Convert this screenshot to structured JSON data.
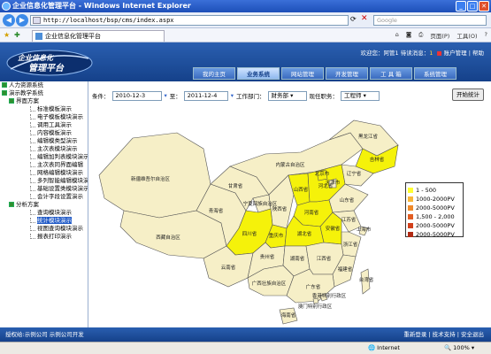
{
  "window": {
    "title": "企业信息化管理平台 - Windows Internet Explorer"
  },
  "addressbar": {
    "url": "http://localhost/bsp/cms/index.aspx",
    "search_placeholder": "Google"
  },
  "tab": {
    "label": "企业信息化管理平台"
  },
  "toolbar": {
    "page_label": "页面(P)",
    "tools_label": "工具(O)"
  },
  "header": {
    "logo_text": "企业信息化管理平台",
    "welcome": "欢迎您：阿管1  待读消息：",
    "msg_count": "1",
    "account": "账户管理",
    "help": "帮助"
  },
  "nav": {
    "tabs": [
      "我的主页",
      "业务系统",
      "网站管理",
      "开发管理",
      "工 具 箱",
      "系统管理"
    ],
    "active": 1
  },
  "sidebar": {
    "items": [
      {
        "label": "人力资源系统",
        "level": 0
      },
      {
        "label": "演示教学系统",
        "level": 0
      },
      {
        "label": "界面方案",
        "level": 1
      },
      {
        "label": "标准模板演示",
        "level": 2
      },
      {
        "label": "电子模板模块演示",
        "level": 2
      },
      {
        "label": "调用工具演示",
        "level": 2
      },
      {
        "label": "内容模板演示",
        "level": 2
      },
      {
        "label": "编辑模类型演示",
        "level": 2
      },
      {
        "label": "主次表模块演示",
        "level": 2
      },
      {
        "label": "编辑加判表模块演示",
        "level": 2
      },
      {
        "label": "主次表同界面编辑",
        "level": 2
      },
      {
        "label": "网格编辑模块演示",
        "level": 2
      },
      {
        "label": "多列智能编辑模块演示",
        "level": 2
      },
      {
        "label": "基础设置类模块演示",
        "level": 2
      },
      {
        "label": "会计字段设置演示",
        "level": 2
      },
      {
        "label": "分析方案",
        "level": 1
      },
      {
        "label": "查询模块演示",
        "level": 2
      },
      {
        "label": "统计模块演示",
        "level": 2,
        "selected": true
      },
      {
        "label": "视图查询模块演示",
        "level": 2
      },
      {
        "label": "报表打印演示",
        "level": 2
      }
    ]
  },
  "filter": {
    "start_label": "条件：",
    "start_date": "2010-12-3",
    "to_label": "至：",
    "end_date": "2011-12-4",
    "dept_label": "工作部门：",
    "dept_value": "财务部",
    "job_label": "现任职务：",
    "job_value": "工程师",
    "stats_button": "开始统计"
  },
  "map": {
    "provinces": [
      {
        "name": "新疆维吾尔自治区",
        "highlight": false
      },
      {
        "name": "西藏自治区",
        "highlight": false
      },
      {
        "name": "青海省",
        "highlight": false
      },
      {
        "name": "甘肃省",
        "highlight": false
      },
      {
        "name": "内蒙古自治区",
        "highlight": false
      },
      {
        "name": "黑龙江省",
        "highlight": false
      },
      {
        "name": "吉林省",
        "highlight": true
      },
      {
        "name": "辽宁省",
        "highlight": false
      },
      {
        "name": "宁夏回族自治区",
        "highlight": false
      },
      {
        "name": "陕西省",
        "highlight": false
      },
      {
        "name": "山西省",
        "highlight": true
      },
      {
        "name": "河北省",
        "highlight": true
      },
      {
        "name": "北京市",
        "highlight": true
      },
      {
        "name": "山东省",
        "highlight": false
      },
      {
        "name": "河南省",
        "highlight": true
      },
      {
        "name": "四川省",
        "highlight": true
      },
      {
        "name": "重庆市",
        "highlight": true
      },
      {
        "name": "湖北省",
        "highlight": true
      },
      {
        "name": "安徽省",
        "highlight": true
      },
      {
        "name": "江苏省",
        "highlight": false
      },
      {
        "name": "上海市",
        "highlight": false
      },
      {
        "name": "浙江省",
        "highlight": false
      },
      {
        "name": "云南省",
        "highlight": false
      },
      {
        "name": "贵州省",
        "highlight": false
      },
      {
        "name": "湖南省",
        "highlight": false
      },
      {
        "name": "江西省",
        "highlight": false
      },
      {
        "name": "福建省",
        "highlight": false
      },
      {
        "name": "台湾省",
        "highlight": false
      },
      {
        "name": "广西壮族自治区",
        "highlight": false
      },
      {
        "name": "广东省",
        "highlight": false
      },
      {
        "name": "香港特别行政区",
        "highlight": false
      },
      {
        "name": "澳门特别行政区",
        "highlight": false
      },
      {
        "name": "海南省",
        "highlight": false
      },
      {
        "name": "天津市",
        "highlight": false
      }
    ]
  },
  "legend": [
    {
      "label": "1 - 500",
      "color": "#ffff33"
    },
    {
      "label": "1000-2000PV",
      "color": "#f7b73a"
    },
    {
      "label": "2000-5000PV",
      "color": "#f08a2a"
    },
    {
      "label": "1,500 - 2,000",
      "color": "#e25d22"
    },
    {
      "label": "2000-5000PV",
      "color": "#d2401c"
    },
    {
      "label": "2000-5000PV",
      "color": "#b02a14"
    }
  ],
  "footer": {
    "left": "授权给:示例公司  示例公司开发",
    "right_items": [
      "重新登录",
      "技术支持",
      "安全退出"
    ]
  },
  "status": {
    "zone": "Internet",
    "zoom": "100%"
  }
}
